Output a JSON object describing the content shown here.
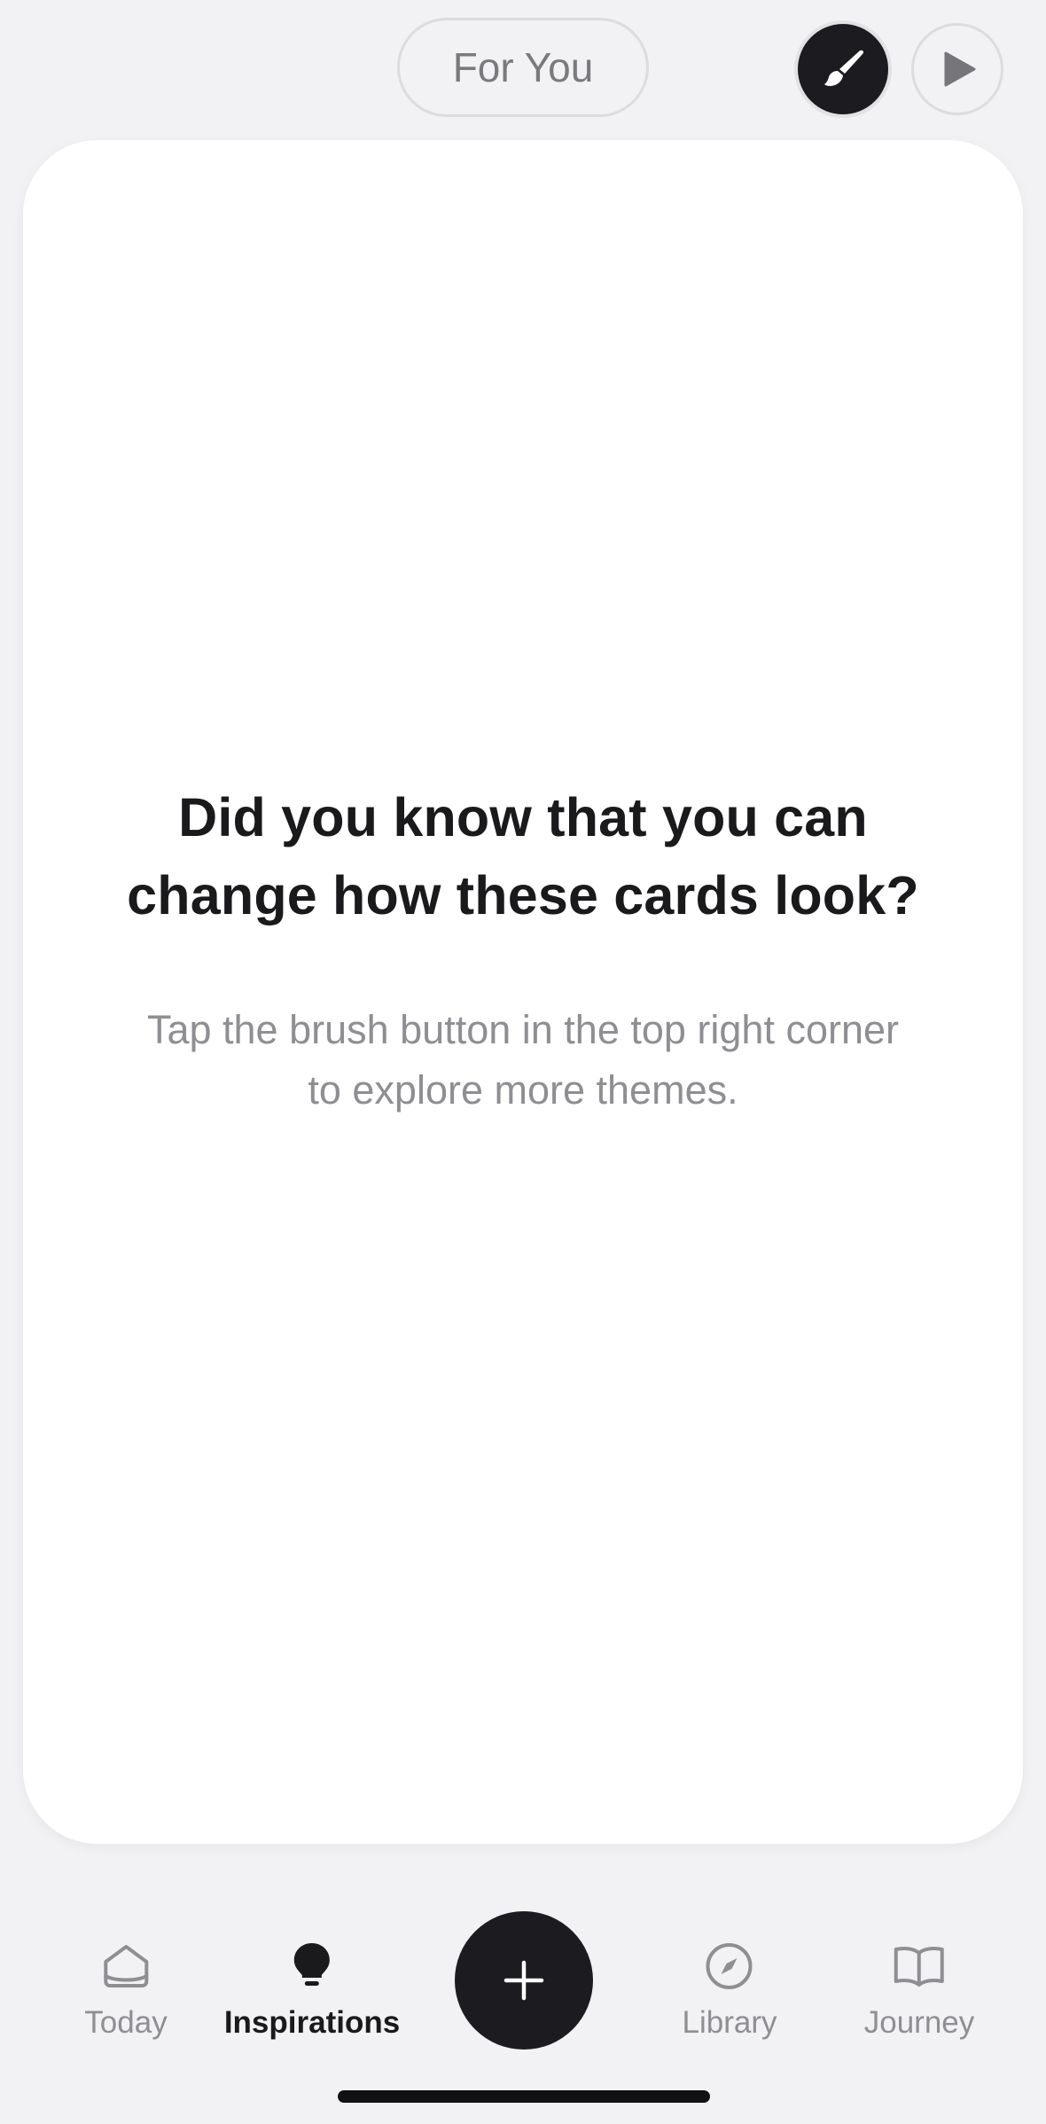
{
  "header": {
    "feed_label": "For You",
    "theme_button_icon": "brush-icon",
    "play_button_icon": "play-icon"
  },
  "card": {
    "title": "Did you know that you can change how these cards look?",
    "subtitle": "Tap the brush button in the top right corner to explore more themes."
  },
  "tabbar": {
    "tabs": [
      {
        "label": "Today",
        "icon": "home-icon",
        "active": false
      },
      {
        "label": "Inspirations",
        "icon": "lightbulb-icon",
        "active": true
      },
      {
        "label": "Library",
        "icon": "compass-icon",
        "active": false
      },
      {
        "label": "Journey",
        "icon": "book-icon",
        "active": false
      }
    ],
    "add_button_icon": "plus-icon"
  },
  "colors": {
    "background": "#F2F2F4",
    "card": "#FFFFFF",
    "accent_dark": "#1C1B1F",
    "text_primary": "#1A1A1C",
    "text_secondary": "#8E8E93"
  }
}
